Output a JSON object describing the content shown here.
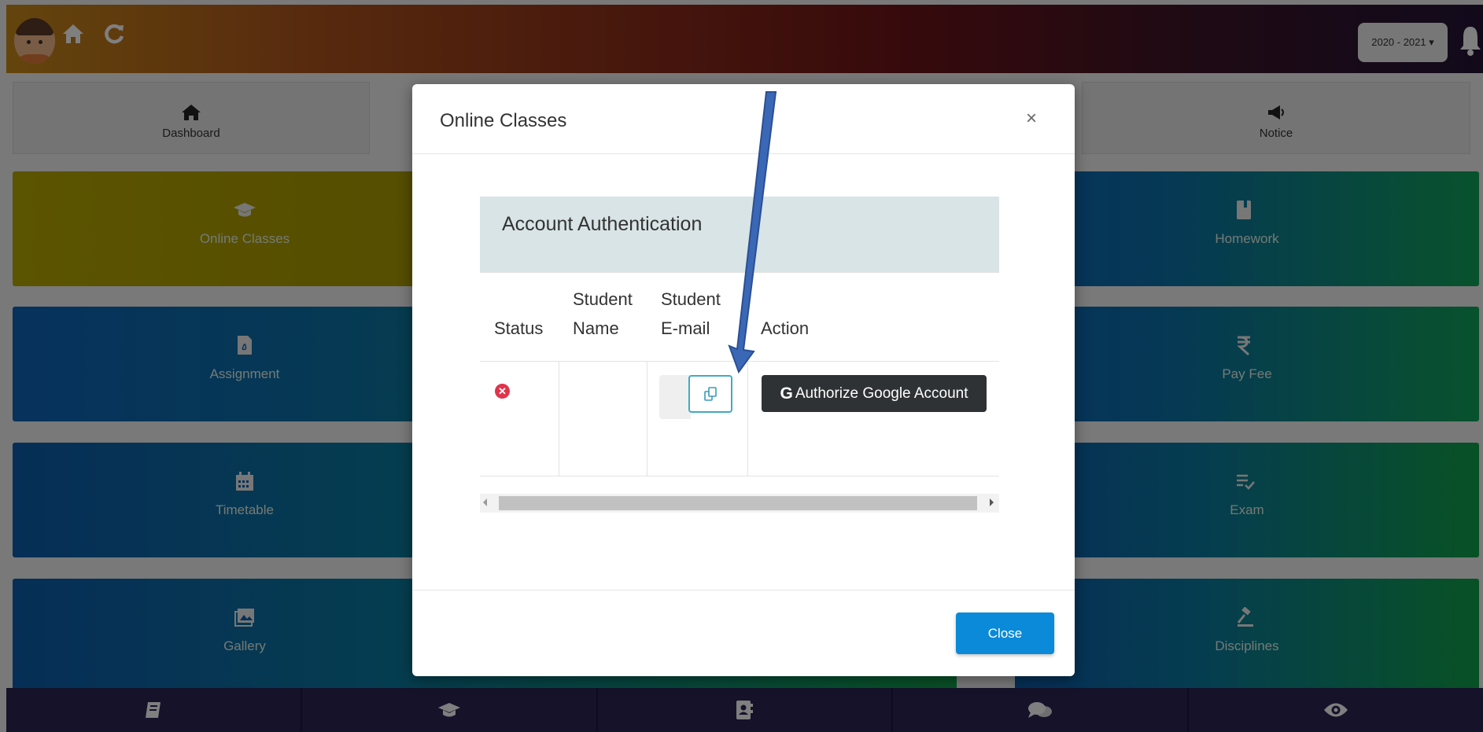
{
  "header": {
    "year_selector": "2020 - 2021 ▾",
    "icons": [
      "avatar",
      "home-icon",
      "refresh-icon",
      "bell-icon"
    ]
  },
  "nav": {
    "tabs": [
      {
        "label": "Dashboard",
        "icon": "home-icon"
      },
      {
        "label": "Notice",
        "icon": "bullhorn-icon"
      }
    ]
  },
  "tiles": {
    "left": [
      {
        "label": "Online Classes",
        "icon": "graduation-cap-icon"
      },
      {
        "label": "Assignment",
        "icon": "pdf-file-icon"
      },
      {
        "label": "Timetable",
        "icon": "calendar-icon"
      },
      {
        "label": "Gallery",
        "icon": "images-icon"
      }
    ],
    "right": [
      {
        "label": "Homework",
        "icon": "book-icon"
      },
      {
        "label": "Pay Fee",
        "icon": "rupee-icon"
      },
      {
        "label": "Exam",
        "icon": "checklist-icon"
      },
      {
        "label": "Disciplines",
        "icon": "gavel-icon"
      }
    ]
  },
  "footer": {
    "icons": [
      "book-icon",
      "graduation-cap-icon",
      "contact-book-icon",
      "comments-icon",
      "eye-icon"
    ]
  },
  "modal": {
    "title": "Online Classes",
    "close_x": "×",
    "card_title": "Account Authentication",
    "columns": {
      "status": "Status",
      "student_name_1": "Student",
      "student_name_2": "Name",
      "student_email_1": "Student",
      "student_email_2": "E-mail",
      "action": "Action"
    },
    "row": {
      "status_icon": "error-icon",
      "auth_button_g": "G",
      "auth_button_label": "Authorize Google Account"
    },
    "close_button": "Close"
  },
  "colors": {
    "accent_blue": "#0a8ad8",
    "error_red": "#e0344c",
    "dark_button": "#2f3234",
    "card_header": "#d8e4e5"
  }
}
